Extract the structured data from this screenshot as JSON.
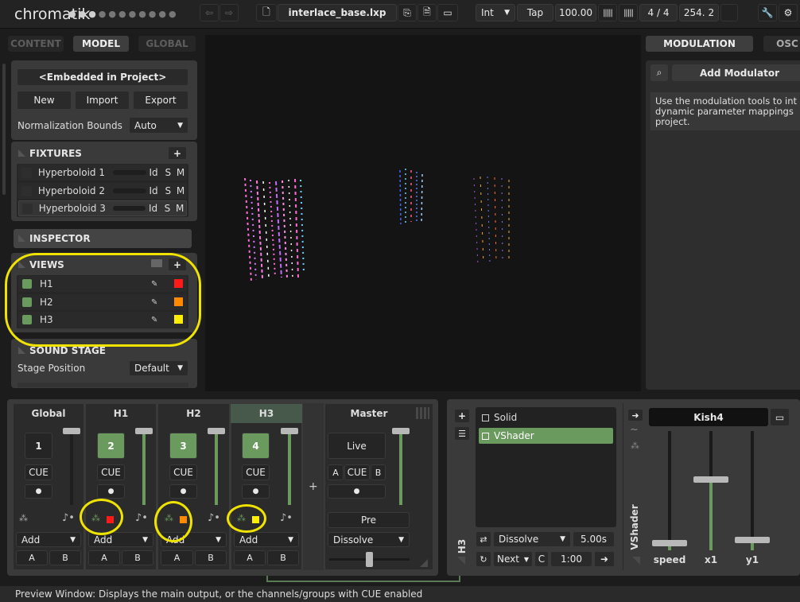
{
  "header": {
    "app_name": "chromatik",
    "project_file": "interlace_base.lxp",
    "clock_mode": "Int",
    "tap_label": "Tap",
    "tempo": "100.00",
    "time_signature": "4 / 4",
    "beat_position": "254. 2"
  },
  "left_tabs": [
    "CONTENT",
    "MODEL",
    "GLOBAL"
  ],
  "model": {
    "embedded": "<Embedded in Project>",
    "new_label": "New",
    "import_label": "Import",
    "export_label": "Export",
    "normalization_label": "Normalization Bounds",
    "normalization_value": "Auto"
  },
  "fixtures": {
    "title": "FIXTURES",
    "items": [
      {
        "name": "Hyperboloid 1",
        "id": "Id",
        "s": "S",
        "m": "M"
      },
      {
        "name": "Hyperboloid 2",
        "id": "Id",
        "s": "S",
        "m": "M"
      },
      {
        "name": "Hyperboloid 3",
        "id": "Id",
        "s": "S",
        "m": "M"
      }
    ]
  },
  "inspector": {
    "title": "INSPECTOR"
  },
  "views": {
    "title": "VIEWS",
    "items": [
      {
        "name": "H1",
        "color": "#ff1a1a"
      },
      {
        "name": "H2",
        "color": "#ff8a00"
      },
      {
        "name": "H3",
        "color": "#ffee00"
      }
    ]
  },
  "sound_stage": {
    "title": "SOUND STAGE",
    "position_label": "Stage Position",
    "position_value": "Default"
  },
  "right_tabs": [
    "MODULATION",
    "OSC"
  ],
  "modulation": {
    "add_label": "Add Modulator",
    "help": "Use the modulation tools to int dynamic parameter mappings project."
  },
  "mixer": {
    "channels": [
      {
        "name": "Global",
        "number": "1",
        "cue": "CUE",
        "blend": "Add",
        "a": "A",
        "b": "B"
      },
      {
        "name": "H1",
        "number": "2",
        "cue": "CUE",
        "blend": "Add",
        "a": "A",
        "b": "B"
      },
      {
        "name": "H2",
        "number": "3",
        "cue": "CUE",
        "blend": "Add",
        "a": "A",
        "b": "B"
      },
      {
        "name": "H3",
        "number": "4",
        "cue": "CUE",
        "blend": "Add",
        "a": "A",
        "b": "B"
      }
    ],
    "master": {
      "name": "Master",
      "live": "Live",
      "a": "A",
      "cue": "CUE",
      "b": "B",
      "pre": "Pre",
      "transition": "Dissolve"
    }
  },
  "patterns": {
    "channel_label": "H3",
    "items": [
      "Solid",
      "VShader"
    ],
    "transition": "Dissolve",
    "duration": "5.00s",
    "next_label": "Next",
    "c_label": "C",
    "time": "1:00"
  },
  "device": {
    "label": "VShader",
    "preset": "Kish4",
    "params": [
      {
        "name": "speed",
        "value": 0.05
      },
      {
        "name": "x1",
        "value": 0.55
      },
      {
        "name": "y1",
        "value": 0.05
      }
    ]
  },
  "status": "Preview Window: Displays the main output, or the channels/groups with CUE enabled"
}
